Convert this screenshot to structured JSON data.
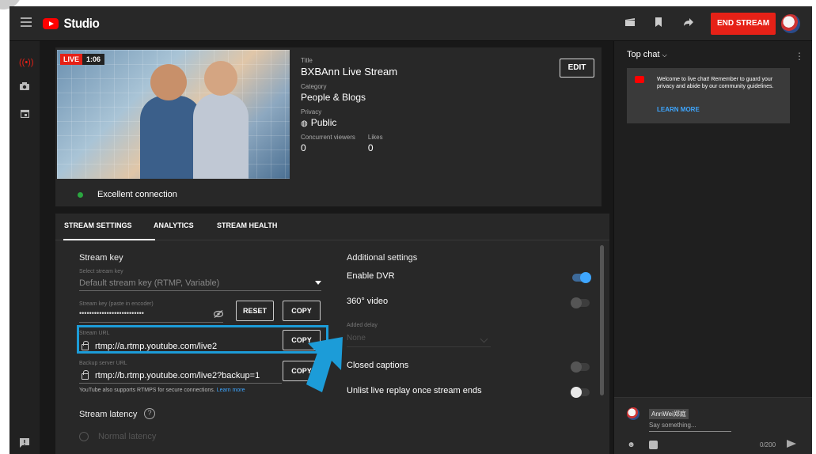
{
  "topbar": {
    "brand": "Studio",
    "end_stream_label": "END STREAM",
    "icons": [
      "menu-icon",
      "clapperboard-icon",
      "bookmark-icon",
      "share-icon"
    ]
  },
  "stream": {
    "live_label": "LIVE",
    "duration": "1:06",
    "title_label": "Title",
    "title": "BXBAnn Live Stream",
    "category_label": "Category",
    "category": "People & Blogs",
    "privacy_label": "Privacy",
    "privacy": "Public",
    "viewers_label": "Concurrent viewers",
    "viewers": "0",
    "likes_label": "Likes",
    "likes": "0",
    "edit_label": "EDIT",
    "connection": "Excellent connection"
  },
  "tabs": [
    "STREAM SETTINGS",
    "ANALYTICS",
    "STREAM HEALTH"
  ],
  "settings": {
    "stream_key_title": "Stream key",
    "select_key_label": "Select stream key",
    "select_key_value": "Default stream key (RTMP, Variable)",
    "key_label": "Stream key (paste in encoder)",
    "key_value": "••••••••••••••••••••••••••",
    "reset_label": "RESET",
    "copy_label": "COPY",
    "url_label": "Stream URL",
    "url_value": "rtmp://a.rtmp.youtube.com/live2",
    "backup_label": "Backup server URL",
    "backup_value": "rtmp://b.rtmp.youtube.com/live2?backup=1",
    "rtmps_note": "YouTube also supports RTMPS for secure connections.",
    "learn_more": "Learn more",
    "latency_title": "Stream latency",
    "latency_option": "Normal latency"
  },
  "additional": {
    "title": "Additional settings",
    "dvr": "Enable DVR",
    "dvr_on": true,
    "video360": "360° video",
    "delay_label": "Added delay",
    "delay_value": "None",
    "captions": "Closed captions",
    "unlist": "Unlist live replay once stream ends"
  },
  "chat": {
    "header": "Top chat",
    "welcome": "Welcome to live chat! Remember to guard your privacy and abide by our community guidelines.",
    "learn_more": "LEARN MORE",
    "user": "AnnWei郑庭",
    "placeholder": "Say something...",
    "count": "0/200"
  },
  "colors": {
    "accent_red": "#e62117",
    "highlight_blue": "#1c9cd8",
    "link_blue": "#3ea6ff"
  }
}
